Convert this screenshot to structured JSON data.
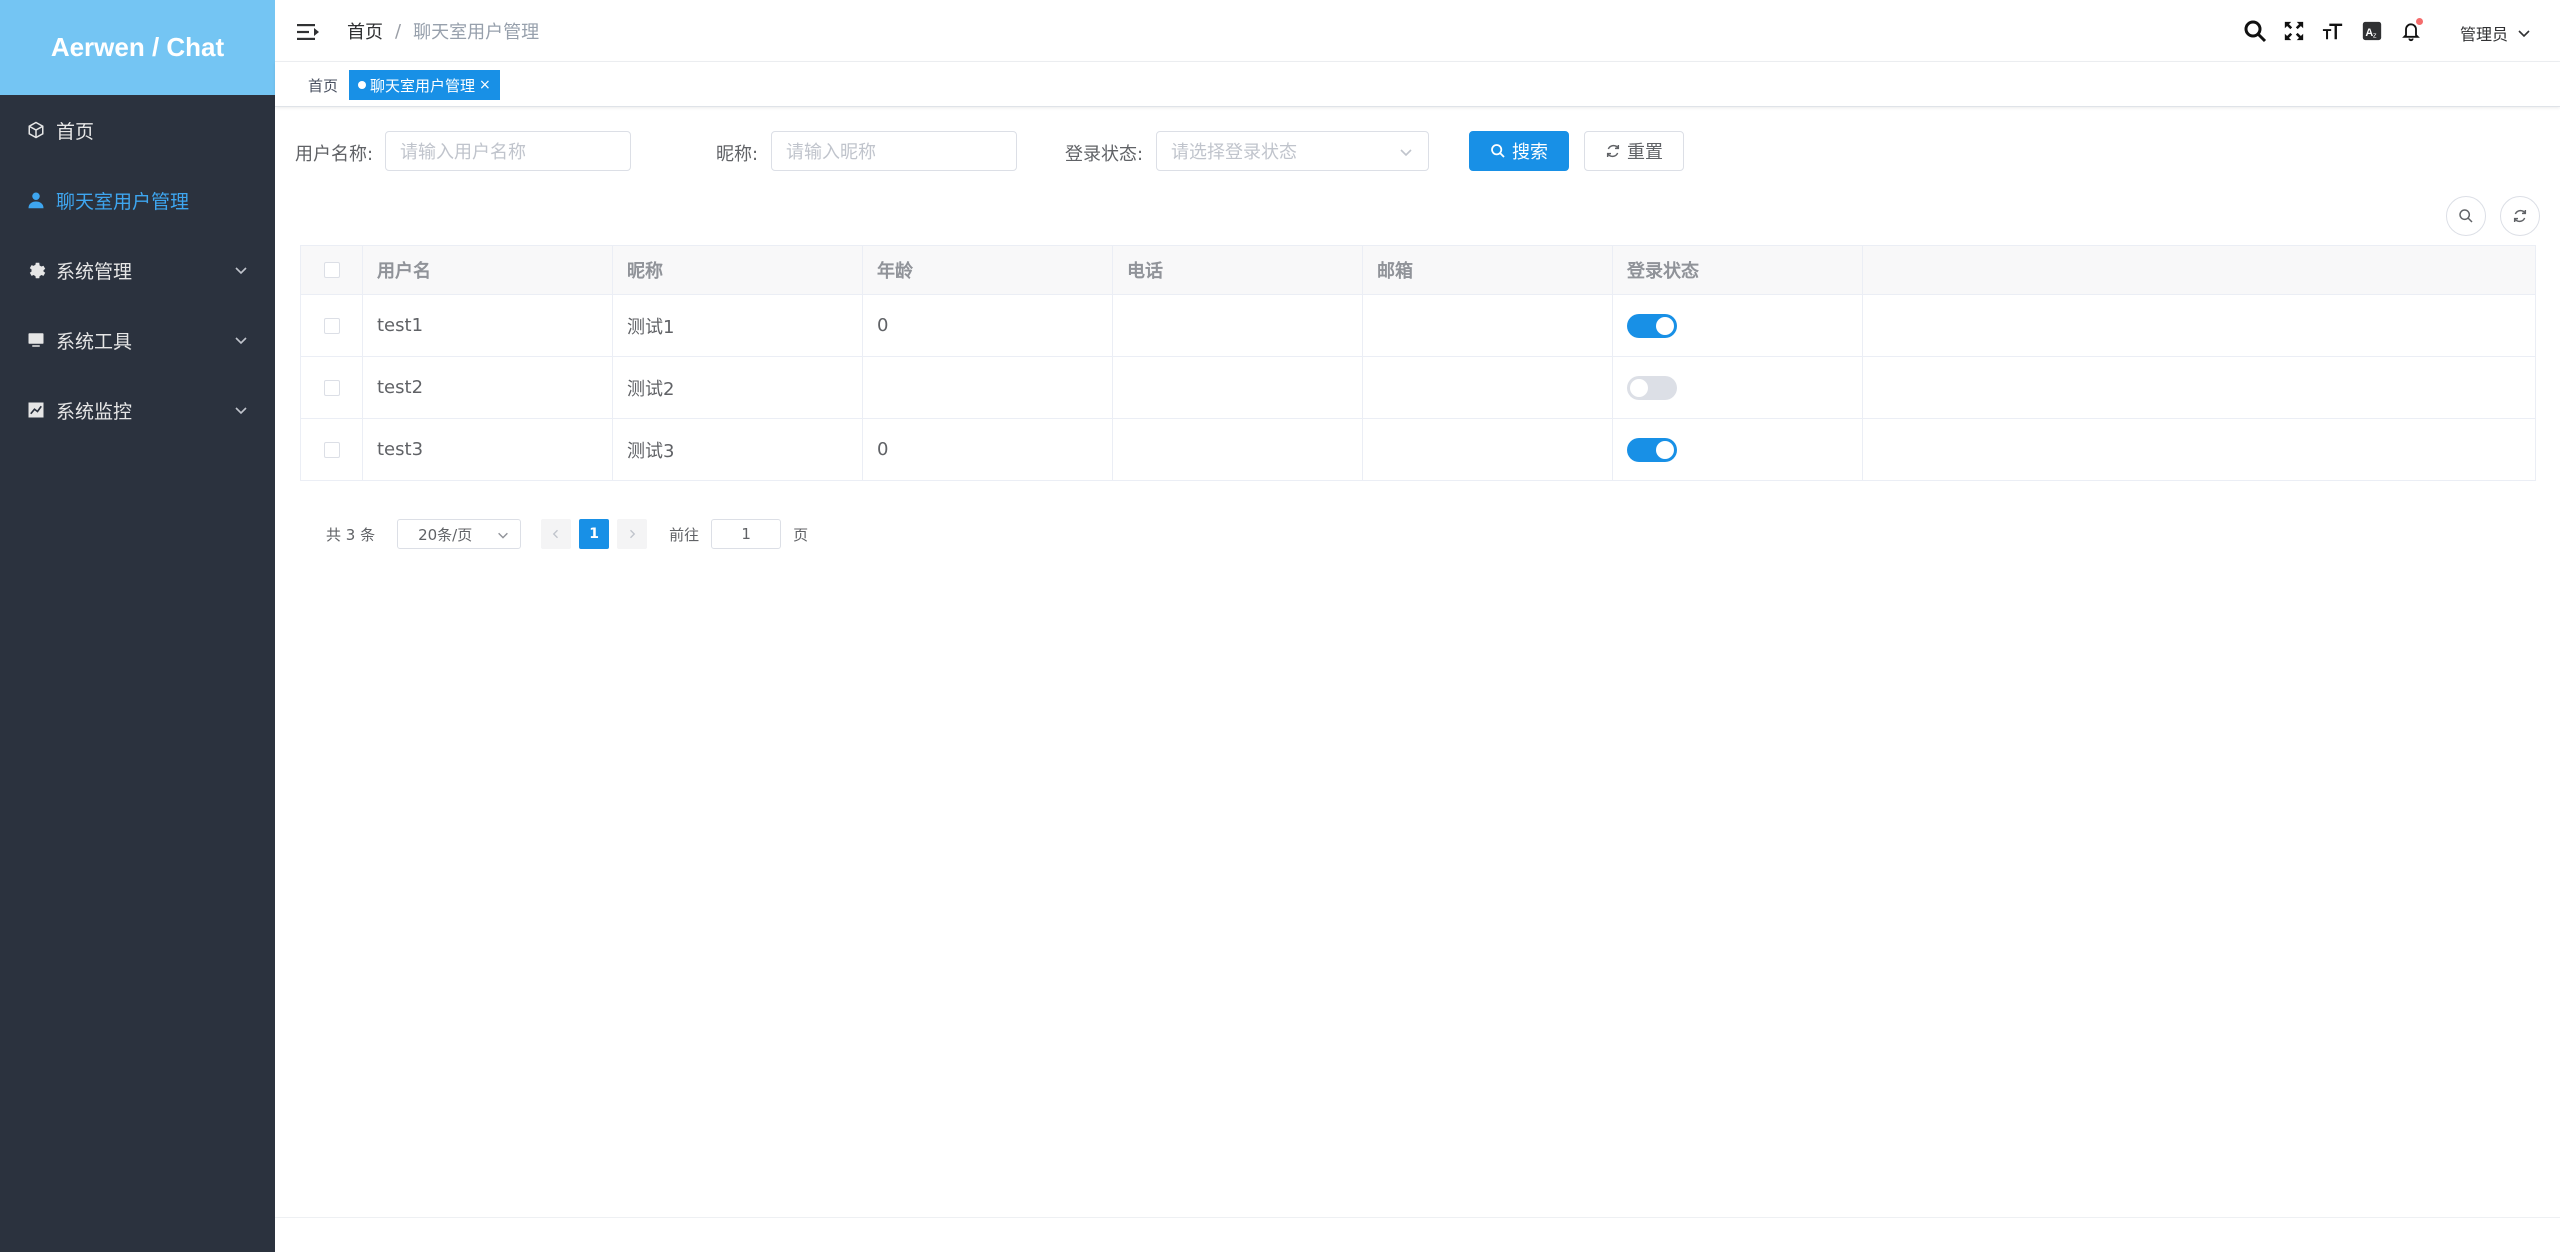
{
  "app": {
    "logo": "Aerwen / Chat"
  },
  "sidebar": {
    "items": [
      {
        "label": "首页",
        "icon": "cube-icon",
        "expandable": false
      },
      {
        "label": "聊天室用户管理",
        "icon": "user-icon",
        "expandable": false,
        "active": true
      },
      {
        "label": "系统管理",
        "icon": "gear-icon",
        "expandable": true
      },
      {
        "label": "系统工具",
        "icon": "monitor-icon",
        "expandable": true
      },
      {
        "label": "系统监控",
        "icon": "chart-icon",
        "expandable": true
      }
    ]
  },
  "header": {
    "breadcrumb": [
      "首页",
      "聊天室用户管理"
    ],
    "user": "管理员"
  },
  "tags": {
    "home": "首页",
    "current": "聊天室用户管理"
  },
  "search": {
    "username_label": "用户名称:",
    "username_placeholder": "请输入用户名称",
    "nickname_label": "昵称:",
    "nickname_placeholder": "请输入昵称",
    "status_label": "登录状态:",
    "status_placeholder": "请选择登录状态",
    "search_button": "搜索",
    "reset_button": "重置"
  },
  "table": {
    "columns": [
      "用户名",
      "昵称",
      "年龄",
      "电话",
      "邮箱",
      "登录状态"
    ],
    "rows": [
      {
        "username": "test1",
        "nickname": "测试1",
        "age": "0",
        "phone": "",
        "email": "",
        "login": true
      },
      {
        "username": "test2",
        "nickname": "测试2",
        "age": "",
        "phone": "",
        "email": "",
        "login": false
      },
      {
        "username": "test3",
        "nickname": "测试3",
        "age": "0",
        "phone": "",
        "email": "",
        "login": true
      }
    ]
  },
  "pagination": {
    "total": "共 3 条",
    "page_size": "20条/页",
    "current": "1",
    "goto_label": "前往",
    "goto_value": "1",
    "unit": "页"
  },
  "colors": {
    "primary": "#1890e6",
    "sidebar": "#2b323e",
    "logo": "#74c5f3"
  }
}
